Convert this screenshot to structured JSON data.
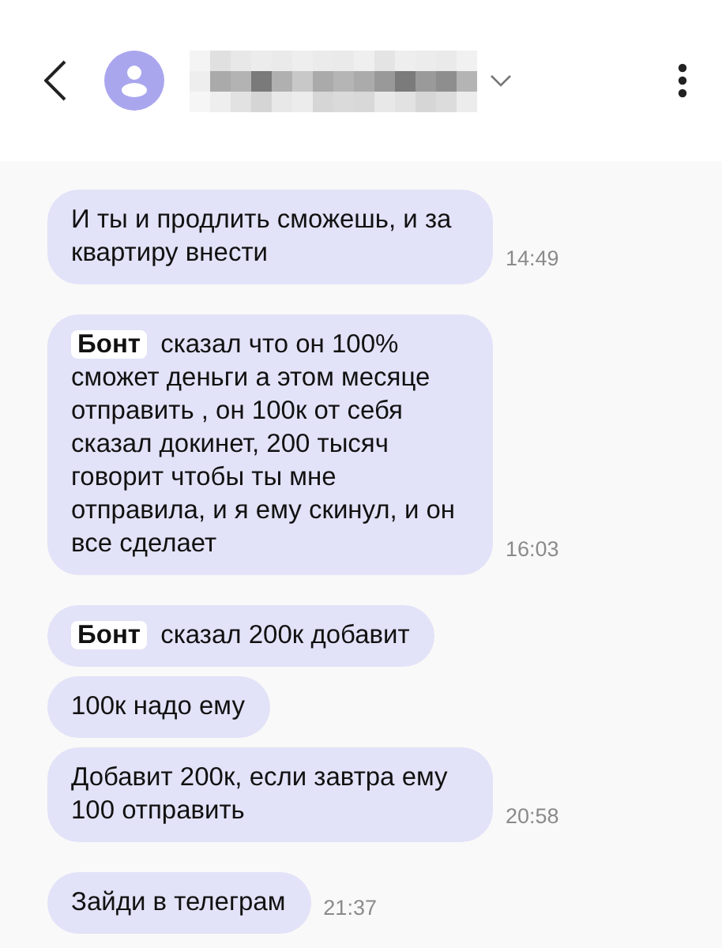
{
  "header": {
    "avatar": {
      "kind": "silhouette"
    },
    "name": {
      "kind": "pixelated"
    }
  },
  "groups": [
    {
      "messages": [
        {
          "text": "И ты и продлить сможешь, и за квартиру внести"
        }
      ],
      "time": "14:49"
    },
    {
      "messages": [
        {
          "mention": "Бонт",
          "text": "сказал что он 100% сможет деньги а этом месяце отправить , он 100к от себя сказал докинет, 200 тысяч говорит чтобы ты мне отправила, и я ему скинул, и он все сделает"
        }
      ],
      "time": "16:03"
    },
    {
      "messages": [
        {
          "mention": "Бонт",
          "text": "сказал 200к добавит"
        },
        {
          "text": "100к надо ему"
        },
        {
          "text": "Добавит 200к, если завтра ему 100 отправить"
        }
      ],
      "time": "20:58"
    },
    {
      "messages": [
        {
          "text": "Зайди в телеграм"
        }
      ],
      "time": "21:37"
    }
  ]
}
